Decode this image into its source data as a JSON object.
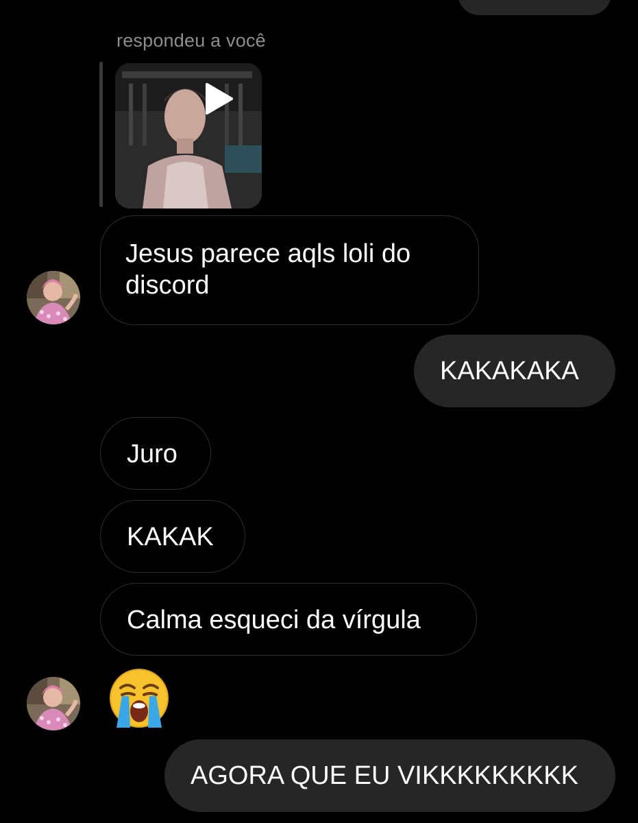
{
  "reply": {
    "label": "respondeu a você"
  },
  "messages": [
    {
      "side": "incoming",
      "text": "Jesus parece aqls loli do discord"
    },
    {
      "side": "outgoing",
      "text": "KAKAKAKA"
    },
    {
      "side": "incoming",
      "text": "Juro"
    },
    {
      "side": "incoming",
      "text": "KAKAK"
    },
    {
      "side": "incoming",
      "text": "Calma esqueci da vírgula"
    },
    {
      "side": "incoming",
      "emoji": "loudly-crying-face"
    },
    {
      "side": "outgoing",
      "text": "AGORA QUE EU VIKKKKKKKKK"
    }
  ],
  "colors": {
    "background": "#000000",
    "outgoing_bubble": "#262626",
    "incoming_border": "#2e2e2e",
    "secondary_text": "#8e8e8e"
  }
}
